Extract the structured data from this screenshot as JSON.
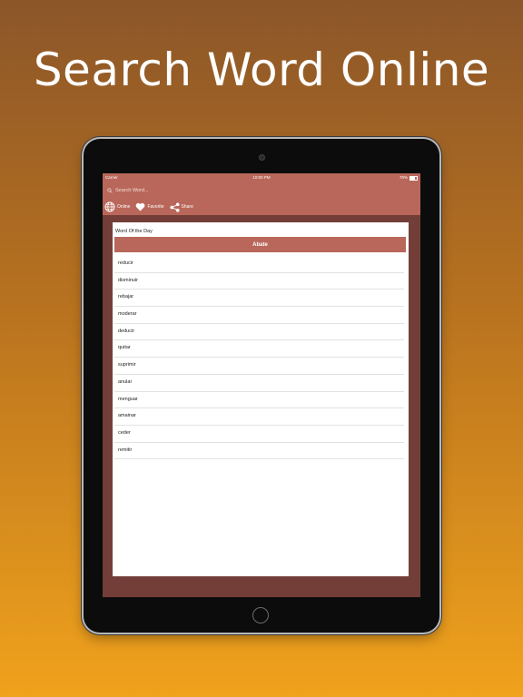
{
  "headline": "Search Word Online",
  "status_bar": {
    "carrier": "Carrier",
    "time": "10:00 PM",
    "battery": "70%"
  },
  "search": {
    "placeholder": "Search Word..."
  },
  "toolbar": {
    "online_label": "Online",
    "favorite_label": "Favorite",
    "share_label": "Share"
  },
  "word_of_day": {
    "title": "Word Of the Day",
    "word": "Abate",
    "synonyms": [
      "reducir",
      "disminuir",
      "rebajar",
      "moderar",
      "deducir",
      "quitar",
      "suprimir",
      "anular",
      "menguar",
      "amainar",
      "ceder",
      "remitir"
    ]
  },
  "colors": {
    "accent": "#b9675a",
    "screen_bg": "#733e37"
  },
  "icons": {
    "search": "search-icon",
    "online": "globe-icon",
    "favorite": "heart-icon",
    "share": "share-icon"
  }
}
